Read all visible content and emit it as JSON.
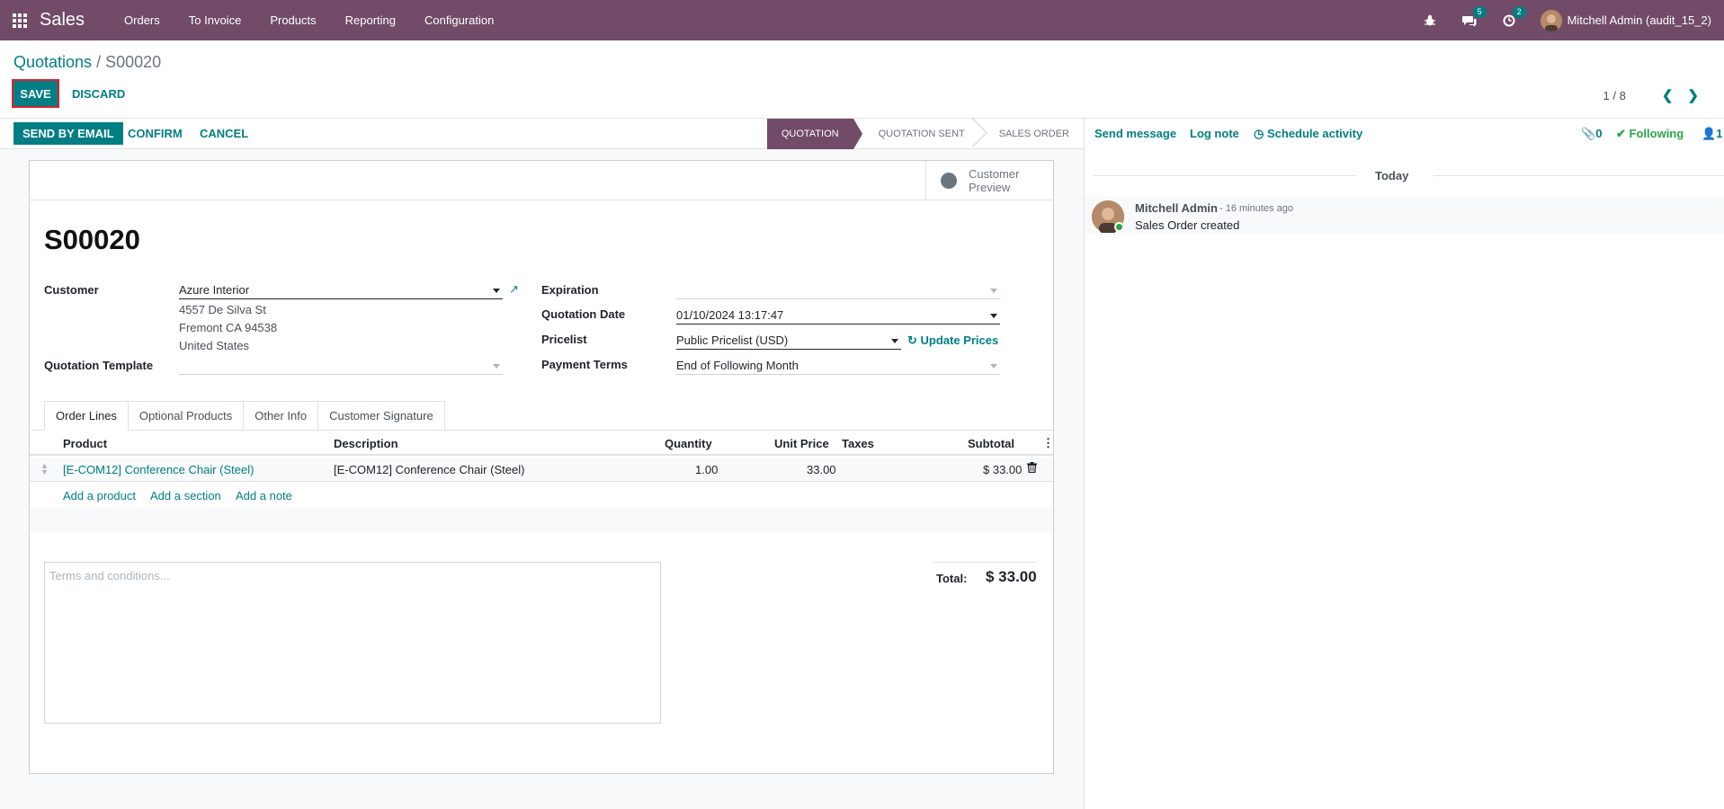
{
  "navbar": {
    "app_name": "Sales",
    "menu": [
      "Orders",
      "To Invoice",
      "Products",
      "Reporting",
      "Configuration"
    ],
    "messages_count": "5",
    "activities_count": "2",
    "user": "Mitchell Admin (audit_15_2)"
  },
  "control": {
    "breadcrumb_parent": "Quotations",
    "breadcrumb_sep": "/",
    "breadcrumb_current": "S00020",
    "save_label": "SAVE",
    "discard_label": "DISCARD",
    "pager": "1 / 8"
  },
  "statusbar": {
    "send_email": "SEND BY EMAIL",
    "confirm": "CONFIRM",
    "cancel": "CANCEL",
    "stages": [
      "QUOTATION",
      "QUOTATION SENT",
      "SALES ORDER"
    ],
    "active_stage": "QUOTATION"
  },
  "form": {
    "preview_line1": "Customer",
    "preview_line2": "Preview",
    "order_name": "S00020",
    "customer_label": "Customer",
    "customer_value": "Azure Interior",
    "address": [
      "4557 De Silva St",
      "Fremont CA 94538",
      "United States"
    ],
    "template_label": "Quotation Template",
    "template_value": "",
    "expiration_label": "Expiration",
    "expiration_value": "",
    "quotation_date_label": "Quotation Date",
    "quotation_date_value": "01/10/2024 13:17:47",
    "pricelist_label": "Pricelist",
    "pricelist_value": "Public Pricelist (USD)",
    "update_prices": "Update Prices",
    "payment_terms_label": "Payment Terms",
    "payment_terms_value": "End of Following Month"
  },
  "tabs": [
    "Order Lines",
    "Optional Products",
    "Other Info",
    "Customer Signature"
  ],
  "table": {
    "headers": {
      "product": "Product",
      "description": "Description",
      "quantity": "Quantity",
      "unit_price": "Unit Price",
      "taxes": "Taxes",
      "subtotal": "Subtotal"
    },
    "rows": [
      {
        "product": "[E-COM12] Conference Chair (Steel)",
        "description": "[E-COM12] Conference Chair (Steel)",
        "quantity": "1.00",
        "unit_price": "33.00",
        "taxes": "",
        "subtotal": "$ 33.00"
      }
    ],
    "add_product": "Add a product",
    "add_section": "Add a section",
    "add_note": "Add a note"
  },
  "terms_placeholder": "Terms and conditions...",
  "totals": {
    "label": "Total:",
    "value": "$ 33.00"
  },
  "chatter": {
    "send_message": "Send message",
    "log_note": "Log note",
    "schedule_activity": "Schedule activity",
    "attachments": "0",
    "following": "Following",
    "followers": "1",
    "today": "Today",
    "message": {
      "author": "Mitchell Admin",
      "time": "- 16 minutes ago",
      "body": "Sales Order created"
    }
  },
  "colors": {
    "brand": "#714b67",
    "accent": "#017e84",
    "highlight_border": "#d9232d"
  }
}
